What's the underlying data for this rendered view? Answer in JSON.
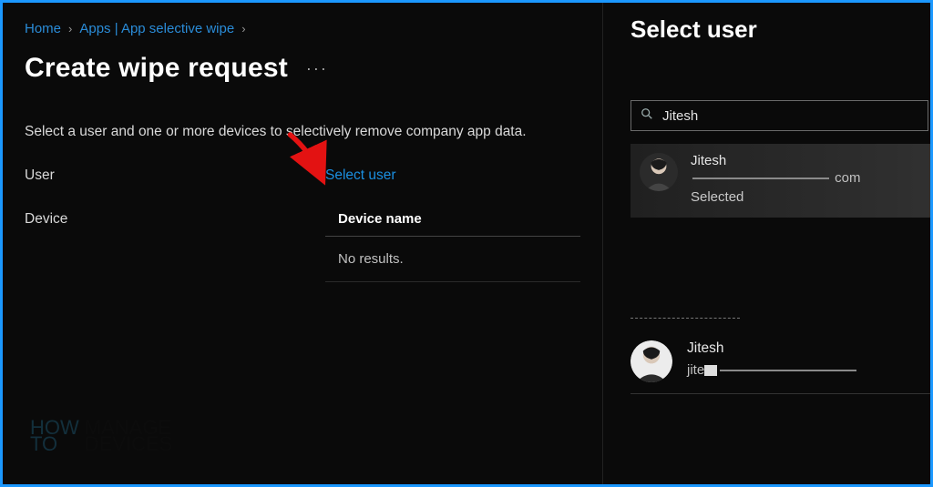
{
  "breadcrumb": {
    "home": "Home",
    "apps": "Apps | App selective wipe"
  },
  "page": {
    "title": "Create wipe request",
    "description": "Select a user and one or more devices to selectively remove company app data."
  },
  "form": {
    "user_label": "User",
    "select_user_link": "Select user",
    "device_label": "Device"
  },
  "device_table": {
    "header": "Device name",
    "empty": "No results."
  },
  "side": {
    "title": "Select user",
    "search_value": "Jitesh",
    "result": {
      "name": "Jitesh",
      "email_suffix": "com",
      "status": "Selected"
    },
    "selected": {
      "name": "Jitesh",
      "email_prefix": "jite"
    }
  },
  "watermark": {
    "l1a": "HOW",
    "l1b": "TO",
    "l2a": "MANAGE",
    "l2b": "DEVICES"
  }
}
